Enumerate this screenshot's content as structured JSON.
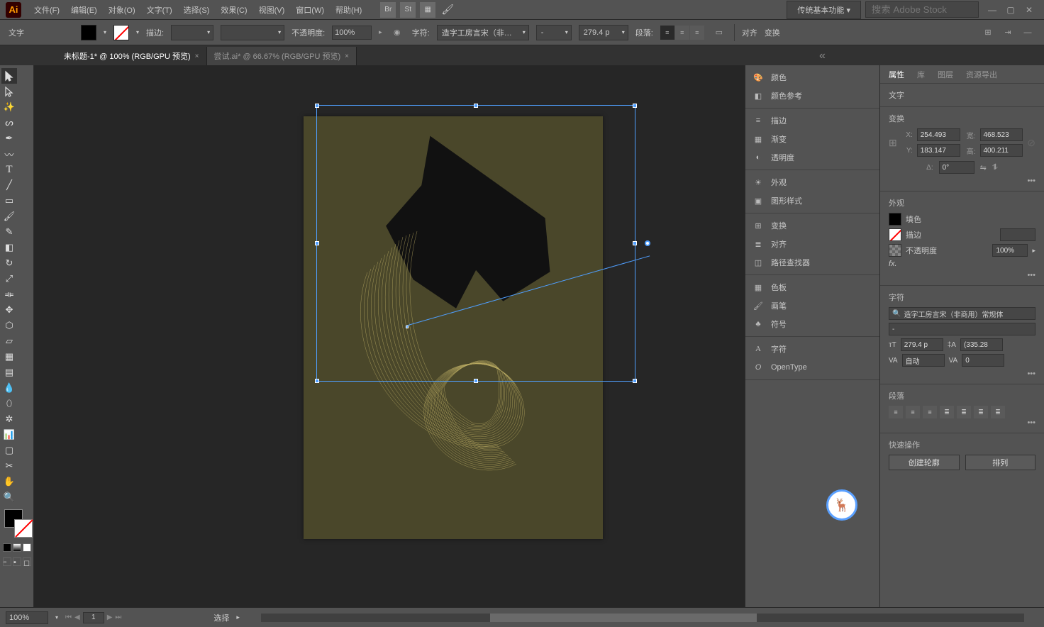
{
  "menu": {
    "items": [
      "文件(F)",
      "编辑(E)",
      "对象(O)",
      "文字(T)",
      "选择(S)",
      "效果(C)",
      "视图(V)",
      "窗口(W)",
      "帮助(H)"
    ],
    "workspace": "传统基本功能",
    "search_placeholder": "搜索 Adobe Stock"
  },
  "control": {
    "type_label": "文字",
    "stroke_label": "描边:",
    "opacity_label": "不透明度:",
    "opacity_value": "100%",
    "char_label": "字符:",
    "font_name": "造字工房言宋（非…",
    "font_style": "-",
    "font_size": "279.4 p",
    "para_label": "段落:",
    "align_label": "对齐",
    "transform_label": "变换"
  },
  "tabs": [
    {
      "label": "未标题-1* @ 100% (RGB/GPU 预览)",
      "active": true
    },
    {
      "label": "尝试.ai* @ 66.67% (RGB/GPU 预览)",
      "active": false
    }
  ],
  "iconpanel": {
    "groups": [
      [
        "颜色",
        "颜色参考"
      ],
      [
        "描边",
        "渐变",
        "透明度"
      ],
      [
        "外观",
        "图形样式"
      ],
      [
        "变换",
        "对齐",
        "路径查找器"
      ],
      [
        "色板",
        "画笔",
        "符号"
      ],
      [
        "字符",
        "OpenType"
      ]
    ]
  },
  "rpanel": {
    "tabs": [
      "属性",
      "库",
      "图层",
      "资源导出"
    ],
    "obj_type": "文字",
    "transform_title": "变换",
    "x_lbl": "X:",
    "x": "254.493",
    "y_lbl": "Y:",
    "y": "183.147",
    "w_lbl": "宽:",
    "w": "468.523",
    "h_lbl": "高:",
    "h": "400.211",
    "rot_lbl": "Δ:",
    "rot": "0°",
    "appearance_title": "外观",
    "fill_label": "填色",
    "stroke_label": "描边",
    "opacity_label": "不透明度",
    "opacity_value": "100%",
    "fx_label": "fx.",
    "char_title": "字符",
    "font_name": "造字工房言宋（非商用）常规体",
    "font_style": "-",
    "font_size": "279.4 p",
    "leading": "(335.28",
    "va": "自动",
    "tracking": "0",
    "para_title": "段落",
    "quick_title": "快速操作",
    "btn_outline": "创建轮廓",
    "btn_arrange": "排列"
  },
  "status": {
    "zoom": "100%",
    "page": "1",
    "sel_label": "选择"
  }
}
